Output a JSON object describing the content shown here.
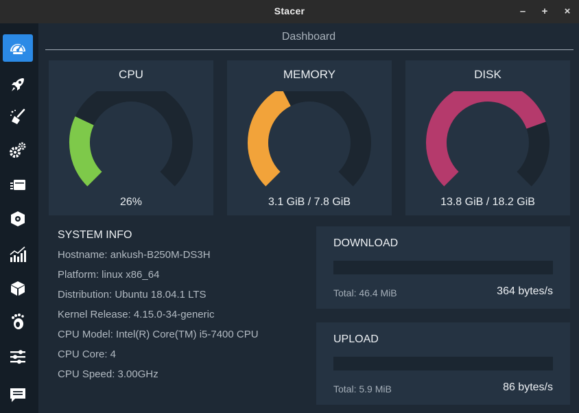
{
  "window": {
    "title": "Stacer",
    "minimize": "–",
    "maximize": "+",
    "close": "×"
  },
  "sidebar": {
    "items": [
      {
        "name": "dashboard",
        "icon": "speedometer-icon",
        "active": true
      },
      {
        "name": "startup-apps",
        "icon": "rocket-icon",
        "active": false
      },
      {
        "name": "system-cleaner",
        "icon": "broom-icon",
        "active": false
      },
      {
        "name": "services",
        "icon": "gears-icon",
        "active": false
      },
      {
        "name": "processes",
        "icon": "processes-icon",
        "active": false
      },
      {
        "name": "uninstaller",
        "icon": "package-icon",
        "active": false
      },
      {
        "name": "resources",
        "icon": "bar-chart-icon",
        "active": false
      },
      {
        "name": "apt-repository",
        "icon": "box-icon",
        "active": false
      },
      {
        "name": "gnome-settings",
        "icon": "gnome-foot-icon",
        "active": false
      },
      {
        "name": "settings",
        "icon": "sliders-icon",
        "active": false
      },
      {
        "name": "feedback",
        "icon": "message-icon",
        "active": false
      }
    ]
  },
  "main": {
    "page_title": "Dashboard"
  },
  "gauges": [
    {
      "title": "CPU",
      "value_text": "26%",
      "fraction": 0.26,
      "color": "#7ec94a"
    },
    {
      "title": "MEMORY",
      "value_text": "3.1 GiB / 7.8 GiB",
      "fraction": 0.4,
      "color": "#f2a33a"
    },
    {
      "title": "DISK",
      "value_text": "13.8 GiB / 18.2 GiB",
      "fraction": 0.76,
      "color": "#b53a6c"
    }
  ],
  "gauge_track_color": "#1c2630",
  "accent_color": "#2b8ae6",
  "system_info": {
    "title": "SYSTEM INFO",
    "rows": [
      "Hostname: ankush-B250M-DS3H",
      "Platform: linux x86_64",
      "Distribution: Ubuntu 18.04.1 LTS",
      "Kernel Release: 4.15.0-34-generic",
      "CPU Model: Intel(R) Core(TM) i5-7400 CPU",
      "CPU Core: 4",
      "CPU Speed: 3.00GHz"
    ]
  },
  "download": {
    "title": "DOWNLOAD",
    "total": "Total: 46.4 MiB",
    "speed": "364 bytes/s",
    "fraction": 0.0
  },
  "upload": {
    "title": "UPLOAD",
    "total": "Total: 5.9 MiB",
    "speed": "86 bytes/s",
    "fraction": 0.0
  }
}
